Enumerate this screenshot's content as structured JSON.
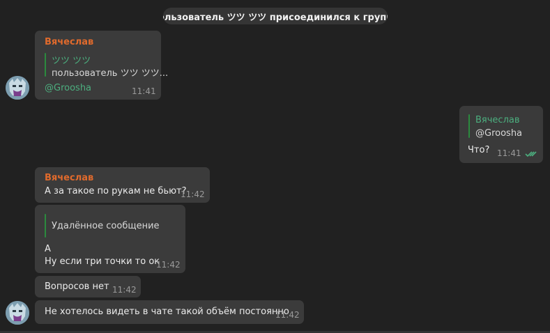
{
  "service_message": "пользователь ツツ ツツ присоединился к группе",
  "messages": {
    "m1": {
      "sender": "Вячеслав",
      "reply_title": "ツツ ツツ",
      "reply_text": "пользователь ツツ ツツ...",
      "text": "@Groosha",
      "time": "11:41"
    },
    "m2": {
      "reply_title": "Вячеслав",
      "reply_text": "@Groosha",
      "text": "Что?",
      "time": "11:41"
    },
    "m3": {
      "sender": "Вячеслав",
      "text": "А за такое по рукам не бьют?",
      "time": "11:42"
    },
    "m4": {
      "reply_text": "Удалённое сообщение",
      "line1": "А",
      "line2": "Ну если три точки то ок",
      "time": "11:42"
    },
    "m5": {
      "text": "Вопросов нет",
      "time": "11:42"
    },
    "m6": {
      "text": "Не хотелось видеть в чате такой объём постоянно",
      "time": "11:42"
    }
  },
  "colors": {
    "background": "#212121",
    "bubble": "#3b3b3b",
    "sender_name": "#e06a2c",
    "accent_green": "#4caf7f",
    "reply_bar": "#2b8a3e"
  },
  "icons": [
    "avatar",
    "double-check-icon"
  ]
}
